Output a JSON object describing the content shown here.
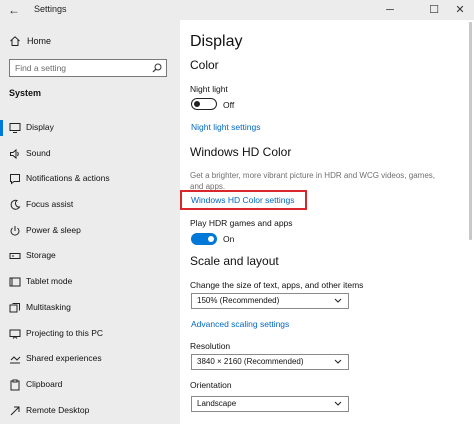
{
  "window": {
    "title": "Settings",
    "back_glyph": "←",
    "minimize_glyph": "─",
    "maximize_glyph": "☐",
    "close_glyph": "✕"
  },
  "sidebar": {
    "home_label": "Home",
    "search_placeholder": "Find a setting",
    "section_label": "System",
    "accent_color": "#0078d7",
    "items": [
      {
        "label": "Display",
        "icon": "display-icon",
        "active": true
      },
      {
        "label": "Sound",
        "icon": "sound-icon"
      },
      {
        "label": "Notifications & actions",
        "icon": "notifications-icon"
      },
      {
        "label": "Focus assist",
        "icon": "focus-assist-icon"
      },
      {
        "label": "Power & sleep",
        "icon": "power-icon"
      },
      {
        "label": "Storage",
        "icon": "storage-icon"
      },
      {
        "label": "Tablet mode",
        "icon": "tablet-mode-icon"
      },
      {
        "label": "Multitasking",
        "icon": "multitasking-icon"
      },
      {
        "label": "Projecting to this PC",
        "icon": "projecting-icon"
      },
      {
        "label": "Shared experiences",
        "icon": "shared-experiences-icon"
      },
      {
        "label": "Clipboard",
        "icon": "clipboard-icon"
      },
      {
        "label": "Remote Desktop",
        "icon": "remote-desktop-icon"
      }
    ]
  },
  "main": {
    "page_title": "Display",
    "color_heading": "Color",
    "night_light_label": "Night light",
    "night_light_state": "Off",
    "night_light_settings_link": "Night light settings",
    "hd_color_heading": "Windows HD Color",
    "hd_color_description": "Get a brighter, more vibrant picture in HDR and WCG videos, games, and apps.",
    "hd_color_settings_link": "Windows HD Color settings",
    "hdr_games_label": "Play HDR games and apps",
    "hdr_games_state": "On",
    "scale_heading": "Scale and layout",
    "scale_label": "Change the size of text, apps, and other items",
    "scale_value": "150% (Recommended)",
    "advanced_scaling_link": "Advanced scaling settings",
    "resolution_label": "Resolution",
    "resolution_value": "3840 × 2160 (Recommended)",
    "orientation_label": "Orientation",
    "orientation_value": "Landscape",
    "link_color": "#0067c0",
    "highlight_color": "#d9262c"
  }
}
